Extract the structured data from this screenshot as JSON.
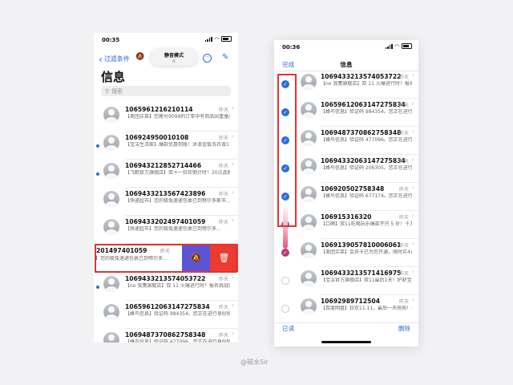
{
  "left": {
    "status_time": "00:35",
    "back_label": "过滤条件",
    "mute_title": "静音模式",
    "mute_state": "开",
    "title": "信息",
    "search_placeholder": "搜索",
    "rows": [
      {
        "sender": "1065961216210114",
        "date": "昨天",
        "preview": "【美团买菜】您尾号9099的订单中有商品因重量/数量不足产生 0.28元退款，正在...",
        "unread": false
      },
      {
        "sender": "106924950010108",
        "date": "昨天",
        "preview": "【宝洁生活家】爆款优惠到账！沐浪金饭洗衣液17斤，洁净去渍，买2套到手16件...",
        "unread": true
      },
      {
        "sender": "1069432128527144​66",
        "date": "昨天",
        "preview": "【飞鹤官方旗舰店】双十一狂欢倒计时！20点品牌享发券用申空降直播间。88VI...",
        "unread": true
      },
      {
        "sender": "1069433213567423896",
        "date": "昨天",
        "preview": "【快递超市】您的极兔速递包裹已到鄂尔多斯市...",
        "unread": false
      },
      {
        "sender": "1069433202497401059",
        "date": "昨天",
        "preview": "【快递超市】您的极兔速递包裹已到鄂尔多...",
        "unread": false
      }
    ],
    "swipe_row": {
      "sender": "201497401059",
      "date": "昨天",
      "preview": "】您的极兔速递包裹已到鄂尔多..."
    },
    "rows_after": [
      {
        "sender": "10694332135740537​22",
        "date": "昨天",
        "preview": "【no 我薰旗舰店】双 11 火爆进行时！报名挑战实满 200 送 200！一起通友打榜藏...",
        "unread": true
      },
      {
        "sender": "1065961206314727​5834",
        "date": "昨天",
        "preview": "【蜂鸟信息】验证码 984354。您正在进行身份验证，打死不要告诉别人哦！",
        "unread": false
      },
      {
        "sender": "1069487370862758348",
        "date": "昨天",
        "preview": "【蜂鸟信息】验证码 477096。您正在进行身份验证...",
        "unread": false
      }
    ]
  },
  "right": {
    "status_time": "00:36",
    "done_label": "完成",
    "title": "信息",
    "read_label": "已读",
    "delete_label": "删除",
    "rows": [
      {
        "sender": "1069433213574053722",
        "date": "昨天",
        "preview": "【no 我薰旗舰店】双 11 火爆进行时！报名挑战实满 200 送 200！一起...",
        "check": "on"
      },
      {
        "sender": "1065961206314727​5834",
        "date": "昨天",
        "preview": "【蜂鸟信息】验证码 984354。您正在进行身份验证，打死不要告诉别人哦！",
        "check": "on"
      },
      {
        "sender": "1069487370862758348",
        "date": "昨天",
        "preview": "【蜂鸟信息】验证码 477096。您正在进行身份验证，打死不要告诉别人哦！",
        "check": "on"
      },
      {
        "sender": "1069433206314727​5834",
        "date": "昨天",
        "preview": "【蜂鸟信息】验证码 206305。您正在进行身份验证，打死不要告诉别人哦！",
        "check": "on"
      },
      {
        "sender": "106920502758348",
        "date": "昨天",
        "preview": "【蜂鸟信息】验证码 677174。您正在进行身份验证，打死不要告诉别人哦！",
        "check": "on"
      },
      {
        "sender": "106915316320",
        "date": "昨天",
        "preview": "【口碑】双11吃喝玩乐爆款不只 5 折！千万红包任性领！快来下单 ▶ ...",
        "check": "faded"
      },
      {
        "sender": "1069139057810006061",
        "date": "昨天",
        "preview": "【美团买菜】会员卡已为您开通，限时买4元，会员卡即将到期...",
        "check": "pink"
      },
      {
        "sender": "1069433213571416975",
        "date": "昨天",
        "preview": "【宝洁官方旗舰店】双11最后1天！护舒宝液体卫生棉9块9秒杀！直播...",
        "check": "off"
      },
      {
        "sender": "1069298971​2504",
        "date": "昨天",
        "preview": "【百度网盘】狂欢11.11，最后一天抢购！会员专享SVIP年卡仅需...",
        "check": "off"
      }
    ]
  },
  "watermark": "@碳水Sir",
  "colors": {
    "accent": "#2a6fdb",
    "danger": "#ec3b30",
    "mute": "#5b55d6",
    "highlight": "#e63131"
  }
}
